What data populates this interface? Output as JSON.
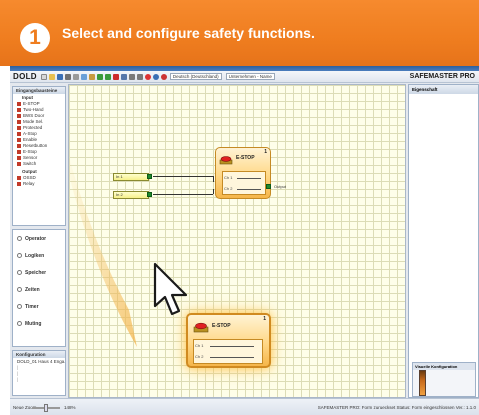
{
  "banner": {
    "step_number": "1",
    "title": "Select and configure safety functions."
  },
  "toolbar": {
    "brand": "DOLD",
    "combo1": "Deutsch (Deutschland)",
    "combo2": "Unternehmen - Name",
    "product": "SAFEMASTER PRO"
  },
  "left": {
    "panel_title": "Eingangsbausteine",
    "input_group": "Input",
    "input_items": [
      "E-STOP",
      "Two-Hand",
      "BWS Door",
      "Mode Sel.",
      "Protected",
      "A-Stop",
      "Enable",
      "Resetbutton",
      "E-Stop",
      "Sensor",
      "Switch"
    ],
    "output_group": "Output",
    "output_items": [
      "OSSD",
      "Relay"
    ],
    "categories": [
      "Operator",
      "Logiken",
      "Speicher",
      "Zeiten",
      "Timer",
      "Muting"
    ],
    "config_title": "Konfiguration",
    "config_item": "DOLD_01 Haus 4 Enga..."
  },
  "right": {
    "panel_title": "Eigenschaft",
    "vis_title": "Visuelle Konfiguration"
  },
  "canvas": {
    "input1": "In 1",
    "input2": "In 2",
    "block_title": "E-STOP",
    "block_num": "1",
    "block_ch1": "Ch 1",
    "block_ch2": "Ch 2",
    "block_output": "Output",
    "drag_title": "E-STOP",
    "drag_num": "1",
    "drag_ch1": "Ch 1",
    "drag_ch2": "Ch 2"
  },
  "status": {
    "zoom_label": "Neue Zoom",
    "zoom_value": "148%",
    "right_text": "SAFEMASTER PRO: Form zurueckset   Status: Form eingeschlossen   Ver.: 1.1.0"
  },
  "colors": {
    "banner": "#ef7d1f",
    "block_fill": "#ffd888",
    "port": "#1f8a2c",
    "canvas": "#fefee9"
  }
}
